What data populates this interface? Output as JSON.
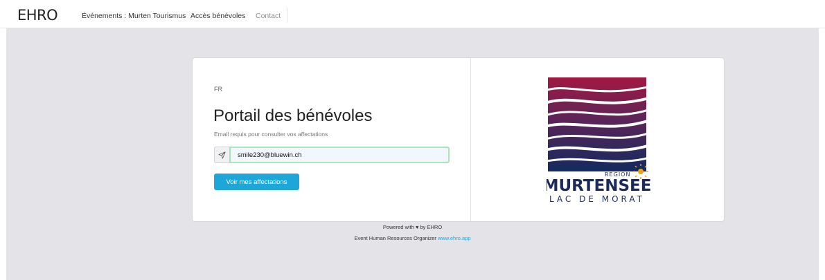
{
  "nav": {
    "brand": "EHRO",
    "events_link": "Événements : Murten Tourismus",
    "volunteer_link": "Accès bénévoles",
    "contact_link": "Contact"
  },
  "portal": {
    "language": "FR",
    "title": "Portail des bénévoles",
    "subtitle": "Email requis pour consulter vos affectations",
    "email_value": "smile230@bluewin.ch",
    "submit_label": "Voir mes affectations"
  },
  "logo": {
    "region": "REGION",
    "name": "MURTENSEE",
    "subname": "LAC DE MORAT"
  },
  "footer": {
    "powered_prefix": "Powered with",
    "heart": "♥",
    "powered_suffix": "by EHRO",
    "organizer_text": "Event Human Resources Organizer",
    "link_text": "www.ehro.app"
  },
  "colors": {
    "accent": "#1fa6d9",
    "background": "#e3e3e8",
    "logo_top": "#a31843",
    "logo_bottom": "#132a5e",
    "logo_text": "#1a2b5a"
  },
  "icons": {
    "send": "paper-plane-icon",
    "sun": "sun-icon"
  }
}
